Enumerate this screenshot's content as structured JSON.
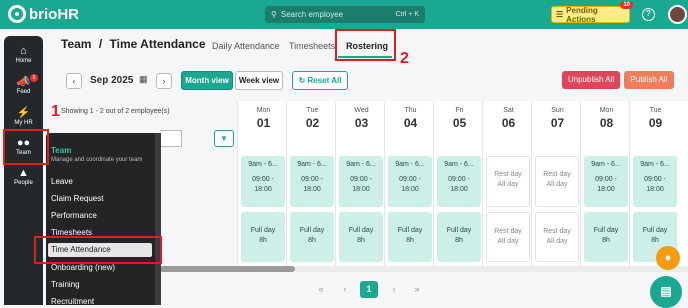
{
  "header": {
    "logo": "brioHR",
    "search_placeholder": "Search employee",
    "search_shortcut": "Ctrl + K",
    "pending_label": "Pending Actions",
    "pending_count": "10",
    "help_icon": "question-circle-icon"
  },
  "sidebar": [
    {
      "label": "Home",
      "icon": "home-icon",
      "badge": ""
    },
    {
      "label": "Feed",
      "icon": "megaphone-icon",
      "badge": "5"
    },
    {
      "label": "My HR",
      "icon": "lightning-icon",
      "badge": ""
    },
    {
      "label": "Team",
      "icon": "team-icon",
      "badge": ""
    },
    {
      "label": "People",
      "icon": "org-chart-icon",
      "badge": ""
    }
  ],
  "page": {
    "breadcrumb_team": "Team",
    "breadcrumb_sep": "/",
    "breadcrumb_page": "Time Attendance"
  },
  "tabs": [
    "Daily Attendance",
    "Timesheets",
    "Rostering"
  ],
  "toolbar": {
    "month": "Sep 2025",
    "month_view": "Month view",
    "week_view": "Week view",
    "reset_all": "Reset All",
    "unpublish_all": "Unpublish All",
    "publish_all": "Publish All",
    "showing": "Showing 1 - 2 out of 2 employee(s)"
  },
  "days": [
    {
      "name": "Mon",
      "num": "01"
    },
    {
      "name": "Tue",
      "num": "02"
    },
    {
      "name": "Wed",
      "num": "03"
    },
    {
      "name": "Thu",
      "num": "04"
    },
    {
      "name": "Fri",
      "num": "05"
    },
    {
      "name": "Sat",
      "num": "06"
    },
    {
      "name": "Sun",
      "num": "07"
    },
    {
      "name": "Mon",
      "num": "08"
    },
    {
      "name": "Tue",
      "num": "09"
    }
  ],
  "row1": [
    {
      "type": "work",
      "l1": "9am - 6...",
      "l2": "09:00 -",
      "l3": "18:00"
    },
    {
      "type": "work",
      "l1": "9am - 6...",
      "l2": "09:00 -",
      "l3": "18:00"
    },
    {
      "type": "work",
      "l1": "9am - 6...",
      "l2": "09:00 -",
      "l3": "18:00"
    },
    {
      "type": "work",
      "l1": "9am - 6...",
      "l2": "09:00 -",
      "l3": "18:00"
    },
    {
      "type": "work",
      "l1": "9am - 6...",
      "l2": "09:00 -",
      "l3": "18:00"
    },
    {
      "type": "rest",
      "l1": "Rest day",
      "l2": "All day",
      "l3": ""
    },
    {
      "type": "rest",
      "l1": "Rest day",
      "l2": "All day",
      "l3": ""
    },
    {
      "type": "work",
      "l1": "9am - 6...",
      "l2": "09:00 -",
      "l3": "18:00"
    },
    {
      "type": "work",
      "l1": "9am - 6...",
      "l2": "09:00 -",
      "l3": "18:00"
    }
  ],
  "row2": [
    {
      "type": "work",
      "l1": "Full day",
      "l2": "8h"
    },
    {
      "type": "work",
      "l1": "Full day",
      "l2": "8h"
    },
    {
      "type": "work",
      "l1": "Full day",
      "l2": "8h"
    },
    {
      "type": "work",
      "l1": "Full day",
      "l2": "8h"
    },
    {
      "type": "work",
      "l1": "Full day",
      "l2": "8h"
    },
    {
      "type": "rest",
      "l1": "Rest day",
      "l2": "All day"
    },
    {
      "type": "rest",
      "l1": "Rest day",
      "l2": "All day"
    },
    {
      "type": "work",
      "l1": "Full day",
      "l2": "8h"
    },
    {
      "type": "work",
      "l1": "Full day",
      "l2": "8h"
    }
  ],
  "pagination": {
    "first": "«",
    "prev": "‹",
    "current": "1",
    "next": "›",
    "last": "»"
  },
  "team_menu": {
    "title": "Team",
    "description": "Manage and coordinate your team",
    "items": [
      "Leave",
      "Claim Request",
      "Performance",
      "Timesheets",
      "Time Attendance",
      "Onboarding (new)",
      "Training",
      "Recruitment"
    ]
  },
  "annotations": {
    "step1": "1",
    "step2": "2"
  },
  "colors": {
    "brand": "#1aa890",
    "highlight": "#e41b1b",
    "unpublish": "#e0455a",
    "publish": "#f07c5c"
  }
}
